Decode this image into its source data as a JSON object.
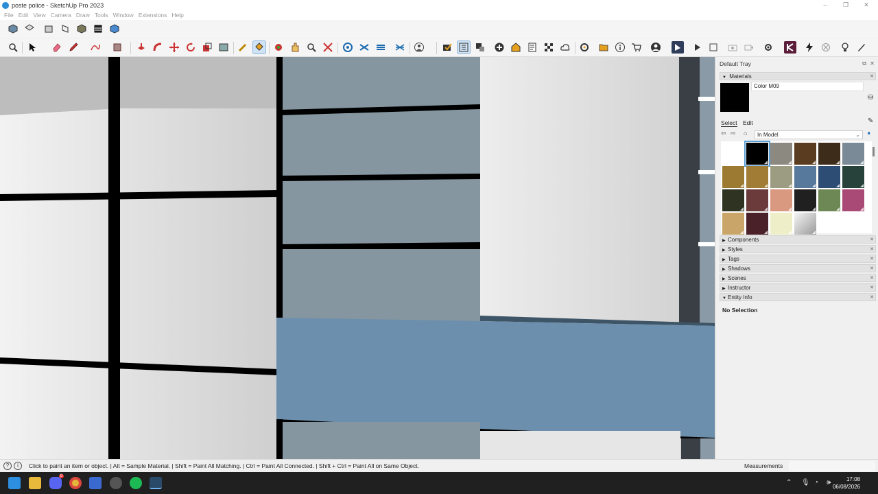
{
  "window": {
    "title": "poste police - SketchUp Pro 2023",
    "controls": [
      "–",
      "❐",
      "✕"
    ]
  },
  "menu": [
    "File",
    "Edit",
    "View",
    "Camera",
    "Draw",
    "Tools",
    "Window",
    "Extensions",
    "Help"
  ],
  "toolbar_views": [
    "iso-view-icon",
    "top-view-icon",
    "front-view-icon",
    "right-view-icon",
    "back-view-icon",
    "left-view-icon",
    "bottom-view-icon"
  ],
  "toolbar_main": [
    "zoom-icon",
    "select-icon",
    "eraser-icon",
    "pencil-icon",
    "freehand-icon",
    "rectangle-icon",
    "push-pull-icon",
    "follow-me-icon",
    "move-icon",
    "rotate-icon",
    "scale-icon",
    "tape-measure-icon",
    "paint-bucket-icon",
    "orbit-icon",
    "pan-icon",
    "zoom-extents-icon",
    "section-plane-icon",
    "section-display-icon",
    "section-fill-icon",
    "section-cut-icon",
    "person-icon",
    "solid-tools-icon",
    "outliner-icon",
    "dimension-icon",
    "add-icon",
    "warehouse-icon",
    "layout-icon",
    "texture-icon",
    "cloud-icon",
    "extension-icon",
    "folder-icon",
    "info-icon",
    "cart-icon",
    "profile-icon",
    "sketchup-icon",
    "play-icon",
    "stop-icon",
    "camera-icon",
    "video-icon",
    "settings-icon",
    "plugin-icon",
    "flash-icon",
    "cancel-icon",
    "bulb-icon",
    "pen-icon"
  ],
  "tray": {
    "title": "Default Tray",
    "materials": {
      "header": "Materials",
      "current_name": "Color M09",
      "tabs": {
        "select": "Select",
        "edit": "Edit"
      },
      "library": "In Model",
      "swatches": [
        "#ffffff",
        "#000000",
        "#8c8980",
        "#5a3d20",
        "#3e2c1a",
        "#7a8a96",
        "#9c7a32",
        "#a07c35",
        "#9c9c82",
        "#577a9c",
        "#2d4d75",
        "#27423a",
        "#2e3322",
        "#6b3b3b",
        "#d99880",
        "#202020",
        "#6e8855",
        "#a84a75",
        "#c9a56a",
        "#4a2029",
        "#eeeec8",
        "#b8b8b8"
      ],
      "selected_index": 1
    },
    "panels": [
      "Components",
      "Styles",
      "Tags",
      "Shadows",
      "Scenes",
      "Instructor"
    ],
    "entity_info": {
      "header": "Entity Info",
      "text": "No Selection"
    }
  },
  "status": {
    "text": "Click to paint an item or object. | Alt = Sample Material. | Shift = Paint All Matching. | Ctrl = Paint All Connected. | Shift + Ctrl = Paint All on Same Object.",
    "measurements_label": "Measurements"
  },
  "taskbar": {
    "icons": [
      "windows-start-icon",
      "file-explorer-icon",
      "discord-icon",
      "chrome-icon",
      "app-icon",
      "app-icon-2",
      "spotify-icon",
      "sketchup-icon"
    ],
    "discord_badge": "9",
    "time": "17:08",
    "date": "06/08/2026"
  },
  "colors": {
    "wall_blue": "#6c8fad",
    "window_gray": "#8596a0",
    "frame": "#000000"
  }
}
